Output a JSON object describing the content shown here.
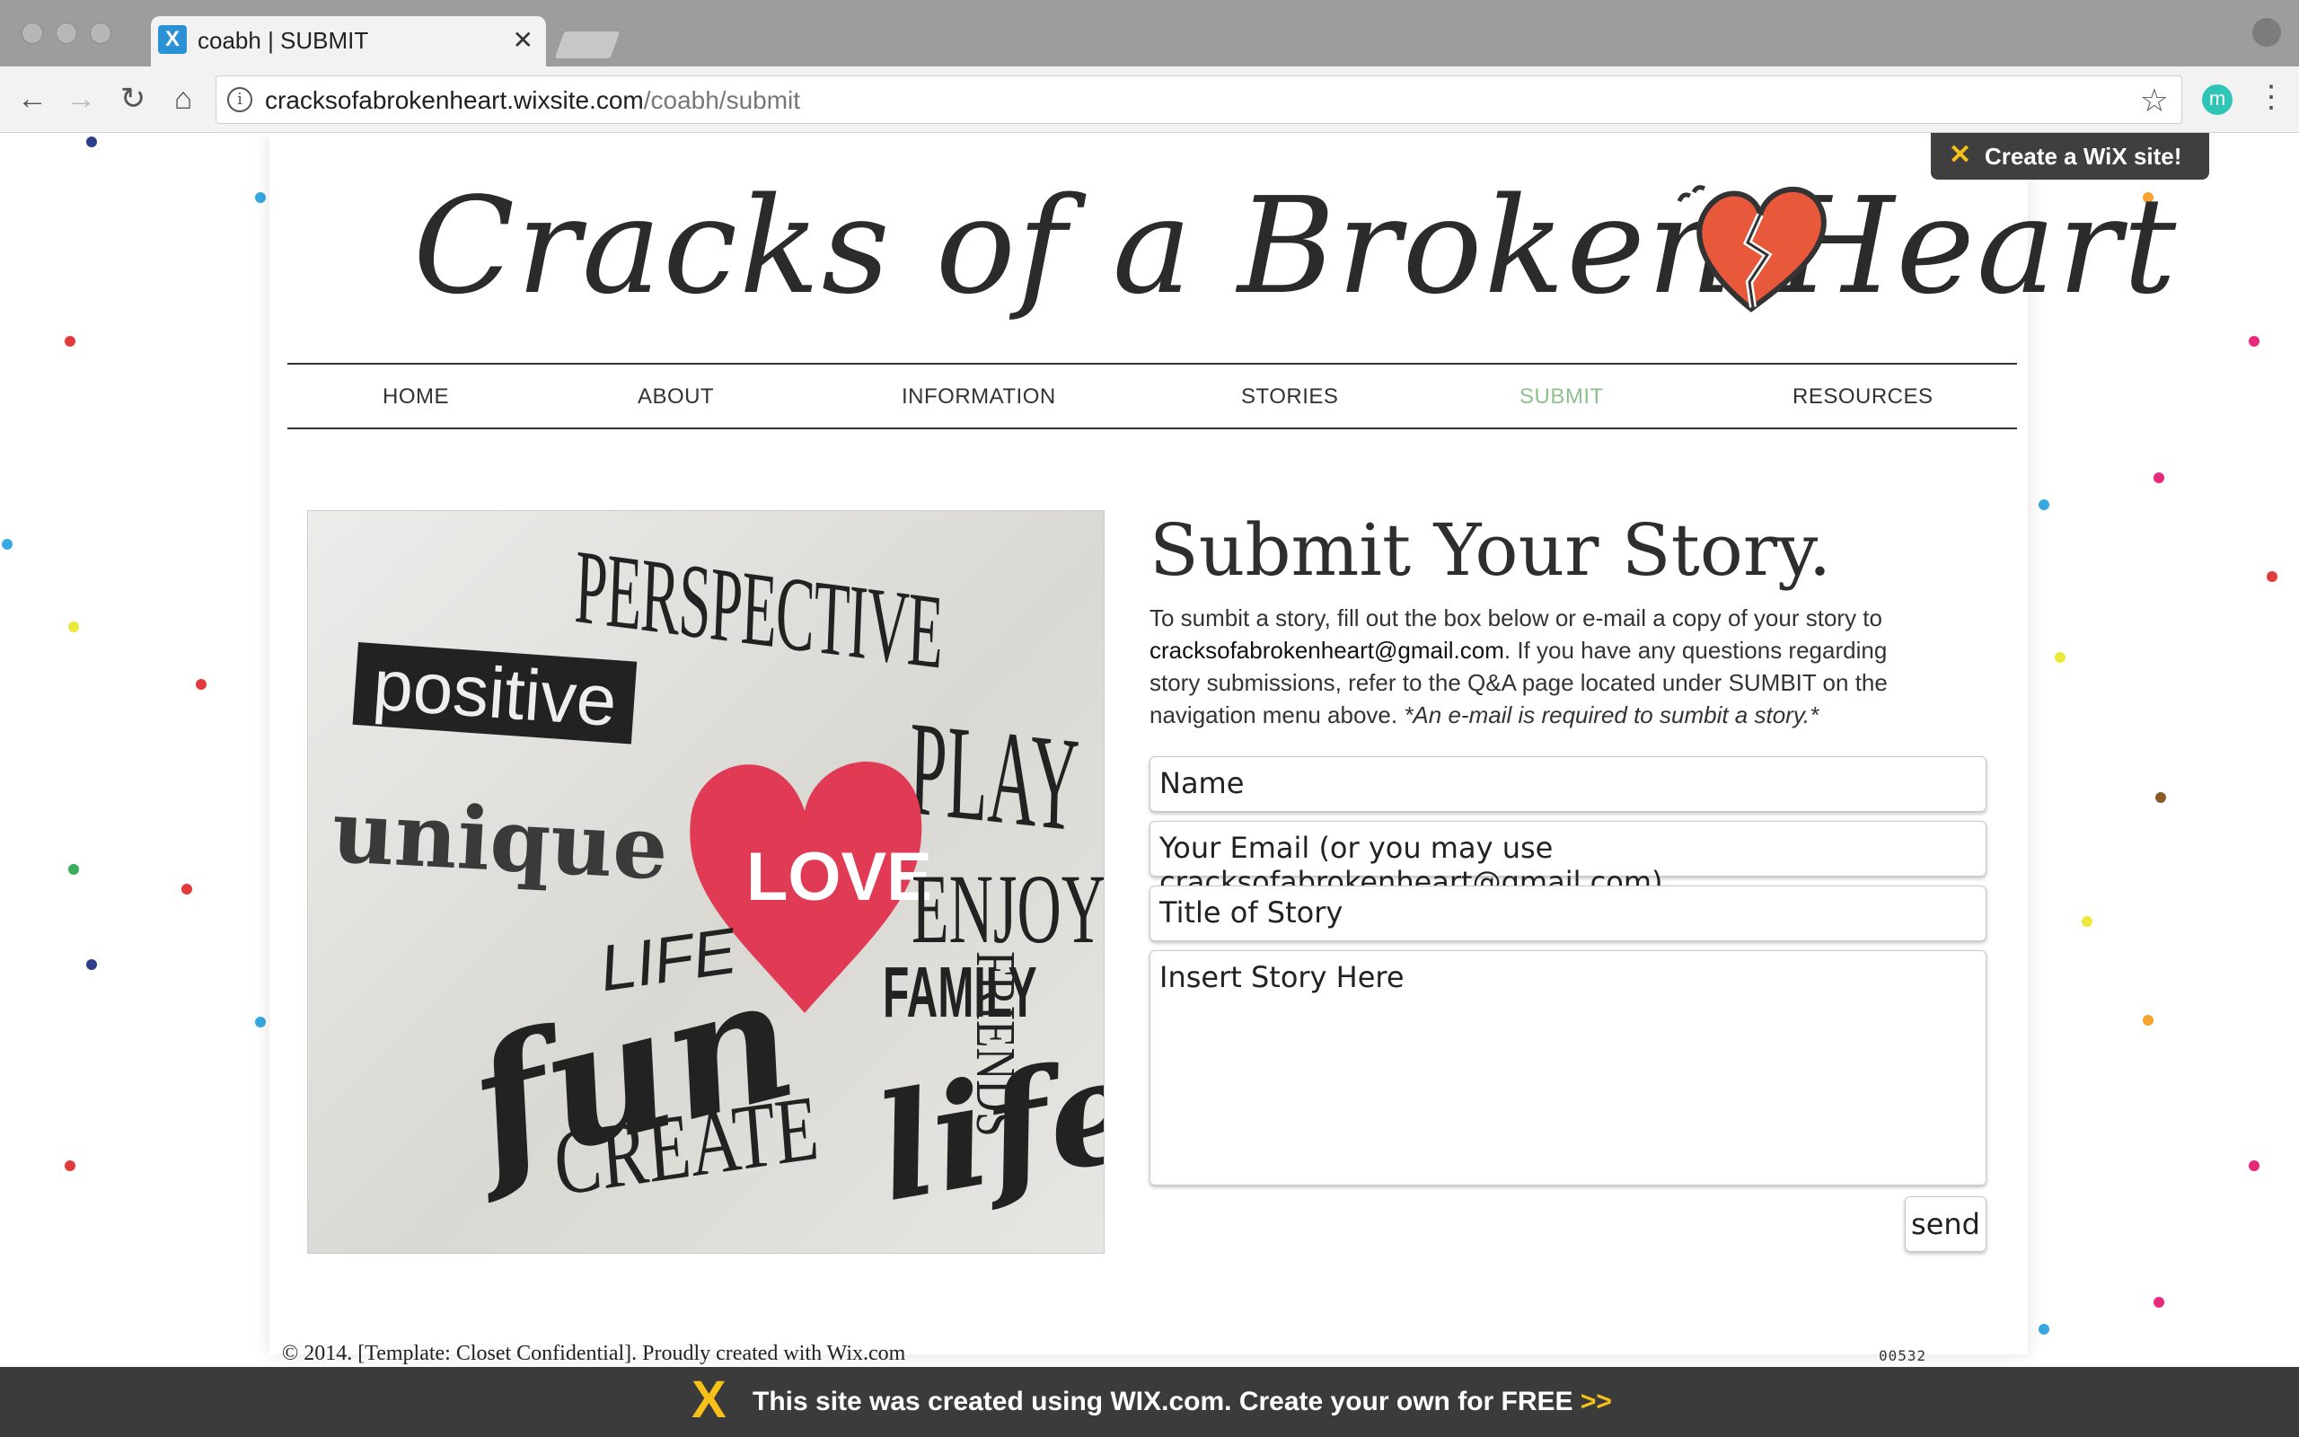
{
  "browser": {
    "tab_title": "coabh | SUBMIT",
    "url_host": "cracksofabrokenheart.wixsite.com",
    "url_path": "/coabh/submit",
    "extension_letter": "m"
  },
  "wix_badge": {
    "label": "Create a WiX site!"
  },
  "site": {
    "logo_text": "Cracks of a Broken Heart",
    "nav": [
      "HOME",
      "ABOUT",
      "INFORMATION",
      "STORIES",
      "SUBMIT",
      "RESOURCES"
    ],
    "active_nav": "SUBMIT"
  },
  "hero_image": {
    "words": {
      "perspective": "PERSPECTIVE",
      "positive": "positive",
      "play": "PLAY",
      "unique": "unique",
      "love": "LOVE",
      "enjoy": "ENJOY",
      "life_caps": "LIFE",
      "family": "FAMILY",
      "friends": "FRIENDS",
      "fun": "fun",
      "create": "CREATE",
      "life": "life"
    }
  },
  "form": {
    "title": "Submit Your Story.",
    "intro_1": "To sumbit a story, fill out the box below or e-mail a copy of your story to ",
    "intro_email": "cracksofabrokenheart@gmail.com",
    "intro_2": ". If you have any questions regarding story submissions, refer to the Q&A page located under SUMBIT on the navigation menu above. ",
    "intro_note": "*An e-mail is required to sumbit a story.*",
    "name_placeholder": "Name",
    "email_placeholder": "Your Email (or you may use cracksofabrokenheart@gmail.com)",
    "title_placeholder": "Title of Story",
    "story_placeholder": "Insert Story Here",
    "send_label": "send"
  },
  "footer": {
    "copyright": "© 2014. [Template: Closet Confidential]. Proudly created with Wix.com",
    "counter": "00532"
  },
  "wix_banner": {
    "text": "This site was created using WIX.com. Create your own for FREE ",
    "arrow": ">>"
  },
  "colors": {
    "active_nav": "#8fbf8f",
    "heart": "#e8583a",
    "love_heart": "#e03a55",
    "wix_yellow": "#f7c11a"
  }
}
